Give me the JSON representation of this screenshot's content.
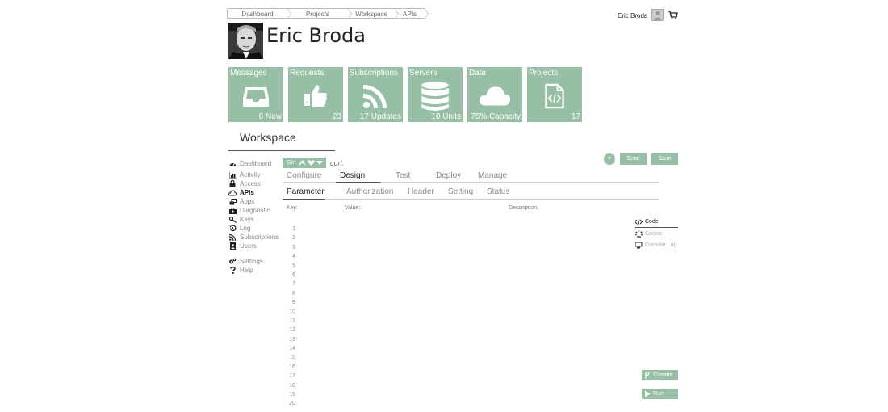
{
  "breadcrumb": [
    "Dashboard",
    "Projects",
    "Workspace",
    "APIs"
  ],
  "header": {
    "user_name": "Eric Broda"
  },
  "profile": {
    "name": "Eric Broda"
  },
  "tiles": [
    {
      "label": "Messages",
      "sub": "6 New",
      "icon": "inbox-icon"
    },
    {
      "label": "Requests",
      "sub": "23",
      "icon": "thumbs-up-icon"
    },
    {
      "label": "Subscriptions",
      "sub": "17 Updates",
      "icon": "rss-icon"
    },
    {
      "label": "Servers",
      "sub": "10 Units",
      "icon": "database-icon"
    },
    {
      "label": "Data",
      "sub": "75% Capacity",
      "icon": "cloud-icon"
    },
    {
      "label": "Projects",
      "sub": "17",
      "icon": "code-file-icon"
    }
  ],
  "workspace": {
    "title": "Workspace"
  },
  "nav": [
    {
      "label": "Dashboard",
      "icon": "dashboard-icon",
      "active": false
    },
    {
      "label": "Activity",
      "icon": "bar-chart-icon",
      "active": false
    },
    {
      "label": "Access",
      "icon": "lock-icon",
      "active": false
    },
    {
      "label": "APIs",
      "icon": "cloud-upload-icon",
      "active": true
    },
    {
      "label": "Apps",
      "icon": "windows-icon",
      "active": false
    },
    {
      "label": "Diagnostic",
      "icon": "medkit-icon",
      "active": false
    },
    {
      "label": "Keys",
      "icon": "key-icon",
      "active": false
    },
    {
      "label": "Log",
      "icon": "history-icon",
      "active": false
    },
    {
      "label": "Subscriptions",
      "icon": "rss-icon",
      "active": false
    },
    {
      "label": "Users",
      "icon": "user-icon",
      "active": false
    },
    {
      "label": "Settings",
      "icon": "gears-icon",
      "active": false
    },
    {
      "label": "Help",
      "icon": "question-icon",
      "active": false
    }
  ],
  "request": {
    "method_label": "Get",
    "curl_placeholder": "curl:",
    "send_label": "Send",
    "save_label": "Save",
    "add_label": "+"
  },
  "tabs_primary": [
    {
      "label": "Configure",
      "active": false
    },
    {
      "label": "Design",
      "active": true
    },
    {
      "label": "Test",
      "active": false
    },
    {
      "label": "Deploy",
      "active": false
    },
    {
      "label": "Manage",
      "active": false
    }
  ],
  "tabs_secondary": [
    {
      "label": "Parameter",
      "active": true
    },
    {
      "label": "Authorization",
      "active": false
    },
    {
      "label": "Header",
      "active": false
    },
    {
      "label": "Setting",
      "active": false
    },
    {
      "label": "Status",
      "active": false
    }
  ],
  "columns": {
    "key": "Key:",
    "value": "Value:",
    "description": "Description:"
  },
  "line_numbers": [
    "1",
    "2",
    "3",
    "4",
    "5",
    "6",
    "7",
    "8",
    "9",
    "10",
    "11",
    "12",
    "13",
    "14",
    "15",
    "16",
    "17",
    "18",
    "19",
    "20"
  ],
  "right_panel": [
    {
      "label": "Code",
      "icon": "code-icon",
      "active": true
    },
    {
      "label": "Cookie",
      "icon": "spinner-icon",
      "active": false
    },
    {
      "label": "Console Log",
      "icon": "desktop-icon",
      "active": false
    }
  ],
  "actions": {
    "commit_label": "Commit",
    "run_label": "Run"
  },
  "colors": {
    "accent": "#96bfa6"
  }
}
